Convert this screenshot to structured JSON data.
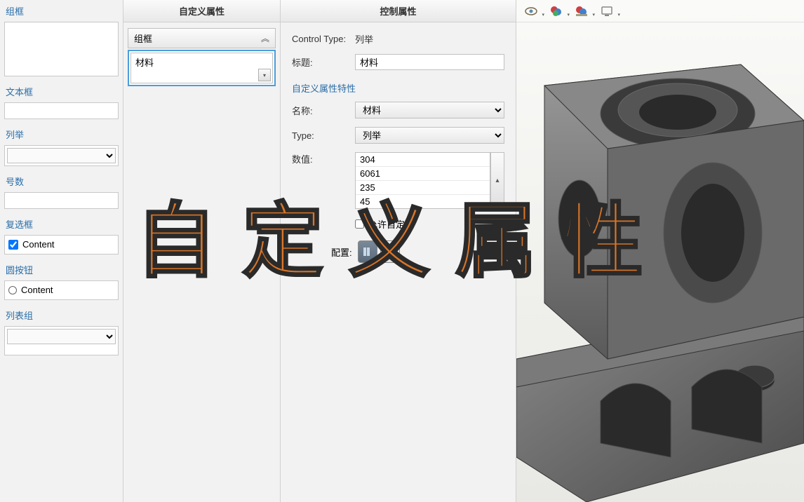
{
  "overlay_title": "自定义属性",
  "toolbox": {
    "groupbox": {
      "header": "组框"
    },
    "textbox": {
      "header": "文本框"
    },
    "enum": {
      "header": "列举"
    },
    "number": {
      "header": "号数"
    },
    "checkbox": {
      "header": "复选框",
      "item_label": "Content",
      "checked": true
    },
    "radio": {
      "header": "圆按钮",
      "item_label": "Content"
    },
    "listgroup": {
      "header": "列表组"
    }
  },
  "custom_panel": {
    "title": "自定义属性",
    "group_header": "组框",
    "material_label": "材料"
  },
  "control_panel": {
    "title": "控制属性",
    "control_type_label": "Control Type:",
    "control_type_value": "列举",
    "caption_label": "标题:",
    "caption_value": "材料",
    "section_title": "自定义属性特性",
    "name_label": "名称:",
    "name_value": "材料",
    "type_label": "Type:",
    "type_value": "列举",
    "values_label": "数值:",
    "values": [
      "304",
      "6061",
      "235",
      "45"
    ],
    "allow_label": "允许自定",
    "config_label": "配置:"
  },
  "viewport": {
    "icons": [
      "eye-icon",
      "appearance-icon",
      "scene-icon",
      "display-icon"
    ]
  }
}
